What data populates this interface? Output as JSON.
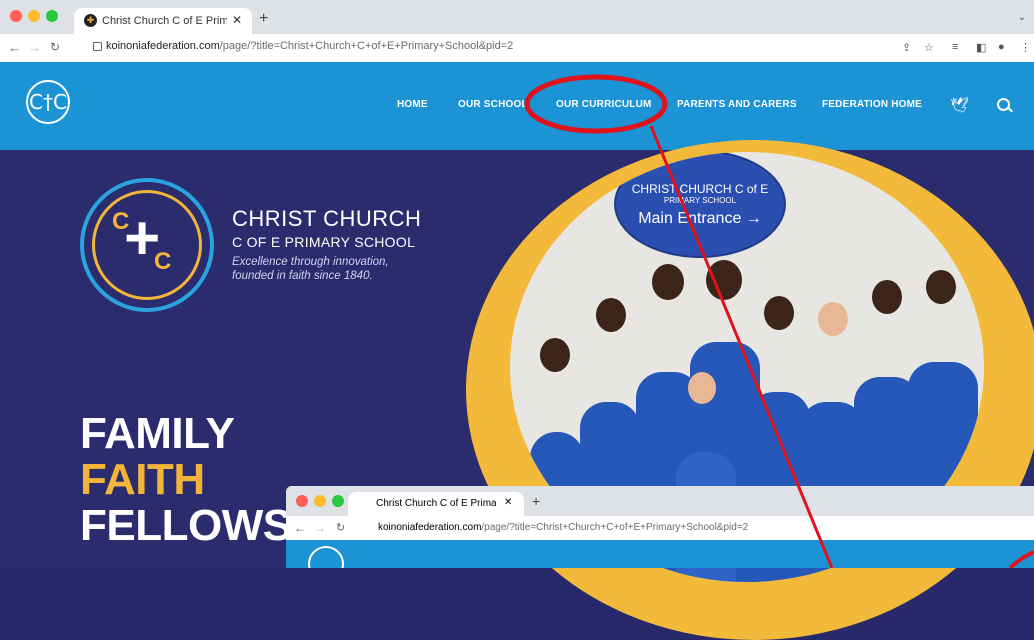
{
  "browser": {
    "tab_title": "Christ Church C of E Primary S",
    "new_tab": "+",
    "url_domain": "koinoniafederation.com",
    "url_rest": "/page/?title=Christ+Church+C+of+E+Primary+School&pid=2"
  },
  "site": {
    "logo_text": "C†C",
    "menu": [
      "HOME",
      "OUR SCHOOL",
      "OUR CURRICULUM",
      "PARENTS AND CARERS",
      "FEDERATION HOME"
    ]
  },
  "hero": {
    "school_name": "CHRIST CHURCH",
    "school_sub": "C OF E PRIMARY SCHOOL",
    "tagline_1": "Excellence through innovation,",
    "tagline_2": "founded in faith since 1840.",
    "words": [
      "FAMILY",
      "FAITH",
      "FELLOWS"
    ],
    "plaque_1": "CHRIST CHURCH C of E",
    "plaque_2": "PRIMARY SCHOOL",
    "plaque_3": "Main Entrance →"
  },
  "colors": {
    "header_blue": "#1c93d4",
    "navy": "#2a2c6e",
    "gold": "#f2b539",
    "annotation_red": "#e0121b"
  },
  "icons": {
    "twitter": "twitter-bird-icon",
    "search": "search-icon"
  }
}
